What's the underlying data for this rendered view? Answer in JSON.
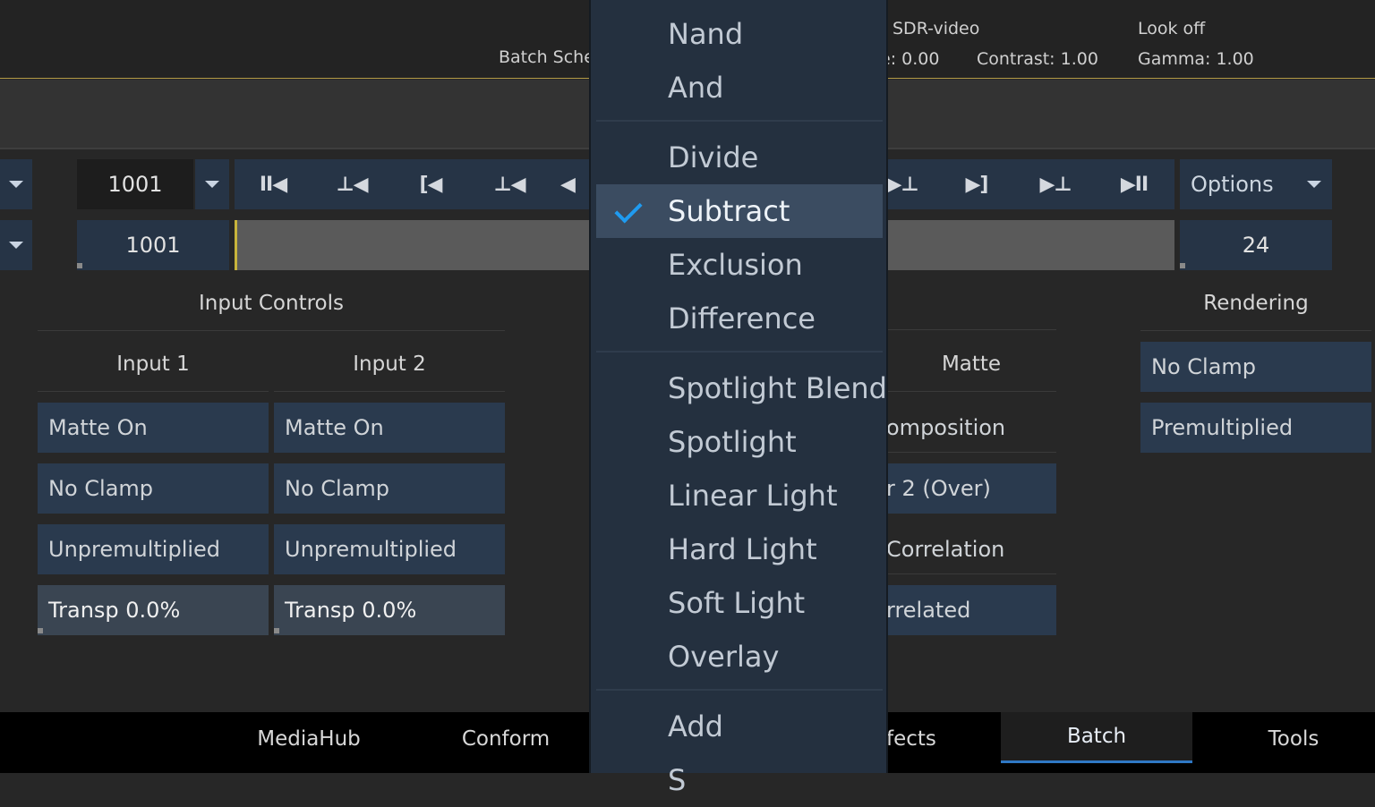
{
  "top_bar": {
    "batch_schedule": "Batch Sche",
    "colour_space": "SDR-video",
    "exposure": "e: 0.00",
    "contrast": "Contrast: 1.00",
    "look": "Look off",
    "gamma": "Gamma: 1.00"
  },
  "transport": {
    "current_frame": "1001",
    "start_frame": "1001",
    "end_frame": "24",
    "options_label": "Options",
    "buttons": [
      {
        "name": "go-to-start-icon",
        "glyph": "II◀"
      },
      {
        "name": "previous-keyframe-icon",
        "glyph": "⊥◀"
      },
      {
        "name": "previous-in-point-icon",
        "glyph": "[◀"
      },
      {
        "name": "previous-frame-marker-icon",
        "glyph": "⊥◀"
      },
      {
        "name": "next-marker-icon",
        "glyph": "▶⊥"
      },
      {
        "name": "next-out-point-icon",
        "glyph": "▶]"
      },
      {
        "name": "next-keyframe-icon",
        "glyph": "▶⊥"
      },
      {
        "name": "go-to-end-icon",
        "glyph": "▶II"
      }
    ]
  },
  "input_controls": {
    "title": "Input Controls",
    "input1": {
      "label": "Input 1",
      "matte": "Matte On",
      "clamp": "No Clamp",
      "premult": "Unpremultiplied",
      "transp": "Transp 0.0%"
    },
    "input2": {
      "label": "Input 2",
      "matte": "Matte On",
      "clamp": "No Clamp",
      "premult": "Unpremultiplied",
      "transp": "Transp 0.0%"
    }
  },
  "matte_panel": {
    "title": "Matte",
    "composition": "omposition",
    "layer": "r 2 (Over)",
    "correlation": "Correlation",
    "correlated": "rrelated"
  },
  "rendering": {
    "title": "Rendering",
    "clamp": "No Clamp",
    "premult": "Premultiplied"
  },
  "blend_menu": {
    "selected": "Subtract",
    "items": {
      "nand": "Nand",
      "and": "And",
      "divide": "Divide",
      "subtract": "Subtract",
      "exclusion": "Exclusion",
      "difference": "Difference",
      "spotlight_blend": "Spotlight Blend",
      "spotlight": "Spotlight",
      "linear_light": "Linear Light",
      "hard_light": "Hard Light",
      "soft_light": "Soft Light",
      "overlay": "Overlay",
      "add": "Add",
      "partial": "S"
    }
  },
  "tabs": {
    "mediahub": "MediaHub",
    "conform": "Conform",
    "effects_partial": "fects",
    "batch": "Batch",
    "tools": "Tools",
    "active": "Batch"
  },
  "colors": {
    "accent": "#1f9bf0",
    "button_bg": "#2a3a4e",
    "menu_bg": "#24303f",
    "timeline_cursor": "#c8b43c"
  }
}
